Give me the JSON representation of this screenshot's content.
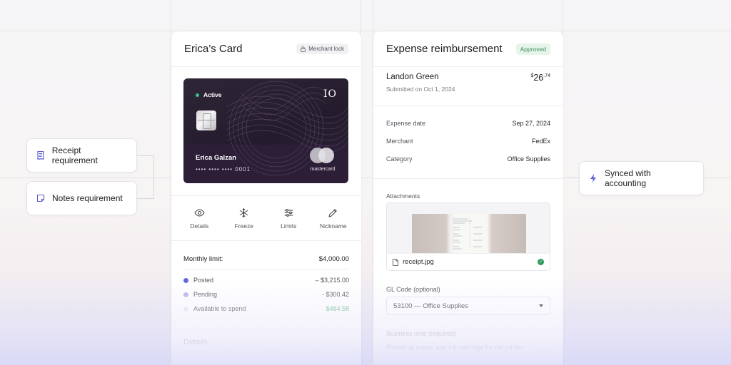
{
  "colors": {
    "accent": "#5b5bd6",
    "approved_green": "#3f8f5c",
    "posted": "#6266e0",
    "pending": "#b4b7f0",
    "available": "#e7e8fb",
    "available_amount": "#5fb88a"
  },
  "left_chips": {
    "receipt": {
      "label": "Receipt requirement",
      "icon": "receipt-icon"
    },
    "notes": {
      "label": "Notes requirement",
      "icon": "note-icon"
    }
  },
  "right_chip": {
    "label": "Synced with accounting",
    "icon": "lightning-icon"
  },
  "card_panel": {
    "title": "Erica’s Card",
    "badge": "Merchant lock",
    "card": {
      "status": "Active",
      "brand": "IO",
      "holder": "Erica Galzan",
      "number": "•••• •••• •••• 0001",
      "network": "mastercard"
    },
    "actions": [
      {
        "label": "Details",
        "icon": "eye-icon"
      },
      {
        "label": "Freeze",
        "icon": "snowflake-icon"
      },
      {
        "label": "Limits",
        "icon": "sliders-icon"
      },
      {
        "label": "Nickname",
        "icon": "pencil-icon"
      }
    ],
    "limit": {
      "label": "Monthly limit:",
      "value": "$4,000.00"
    },
    "spend": [
      {
        "label": "Posted",
        "value": "– $3,215.00"
      },
      {
        "label": "Pending",
        "value": "- $300.42"
      },
      {
        "label": "Available to spend",
        "value": "$484.58"
      }
    ],
    "details_heading": "Details"
  },
  "expense_panel": {
    "title": "Expense reimbursement",
    "badge": "Approved",
    "person": "Landon Green",
    "submitted": "Submitted on Oct 1, 2024",
    "amount_currency": "$",
    "amount_whole": "26",
    "amount_cents": ".74",
    "fields": [
      {
        "label": "Expense date",
        "value": "Sep 27, 2024"
      },
      {
        "label": "Merchant",
        "value": "FedEx"
      },
      {
        "label": "Category",
        "value": "Office Supplies"
      }
    ],
    "attachments_label": "Attachments",
    "file_name": "receipt.jpg",
    "gl_label": "GL Code (optional)",
    "gl_value": "53100 — Office Supplies",
    "note_label": "Business note (required)",
    "note_text": "Picked up paper, and ink cartridge for the printer."
  }
}
